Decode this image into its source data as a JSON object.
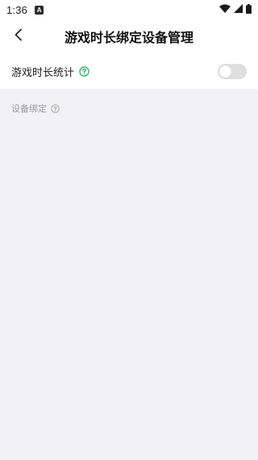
{
  "status_bar": {
    "time": "1:36",
    "notification_glyph": "A",
    "icons": [
      "wifi-icon",
      "signal-icon",
      "battery-icon"
    ]
  },
  "header": {
    "back_icon": "chevron-left-icon",
    "title": "游戏时长绑定设备管理"
  },
  "game_time_stats": {
    "label": "游戏时长统计",
    "help_icon": "question-circle-icon",
    "help_color": "#1aad5c",
    "enabled": false
  },
  "device_binding": {
    "label": "设备绑定",
    "help_icon": "question-circle-icon"
  },
  "colors": {
    "background": "#f2f2f5",
    "toggle_off": "#dedede"
  }
}
